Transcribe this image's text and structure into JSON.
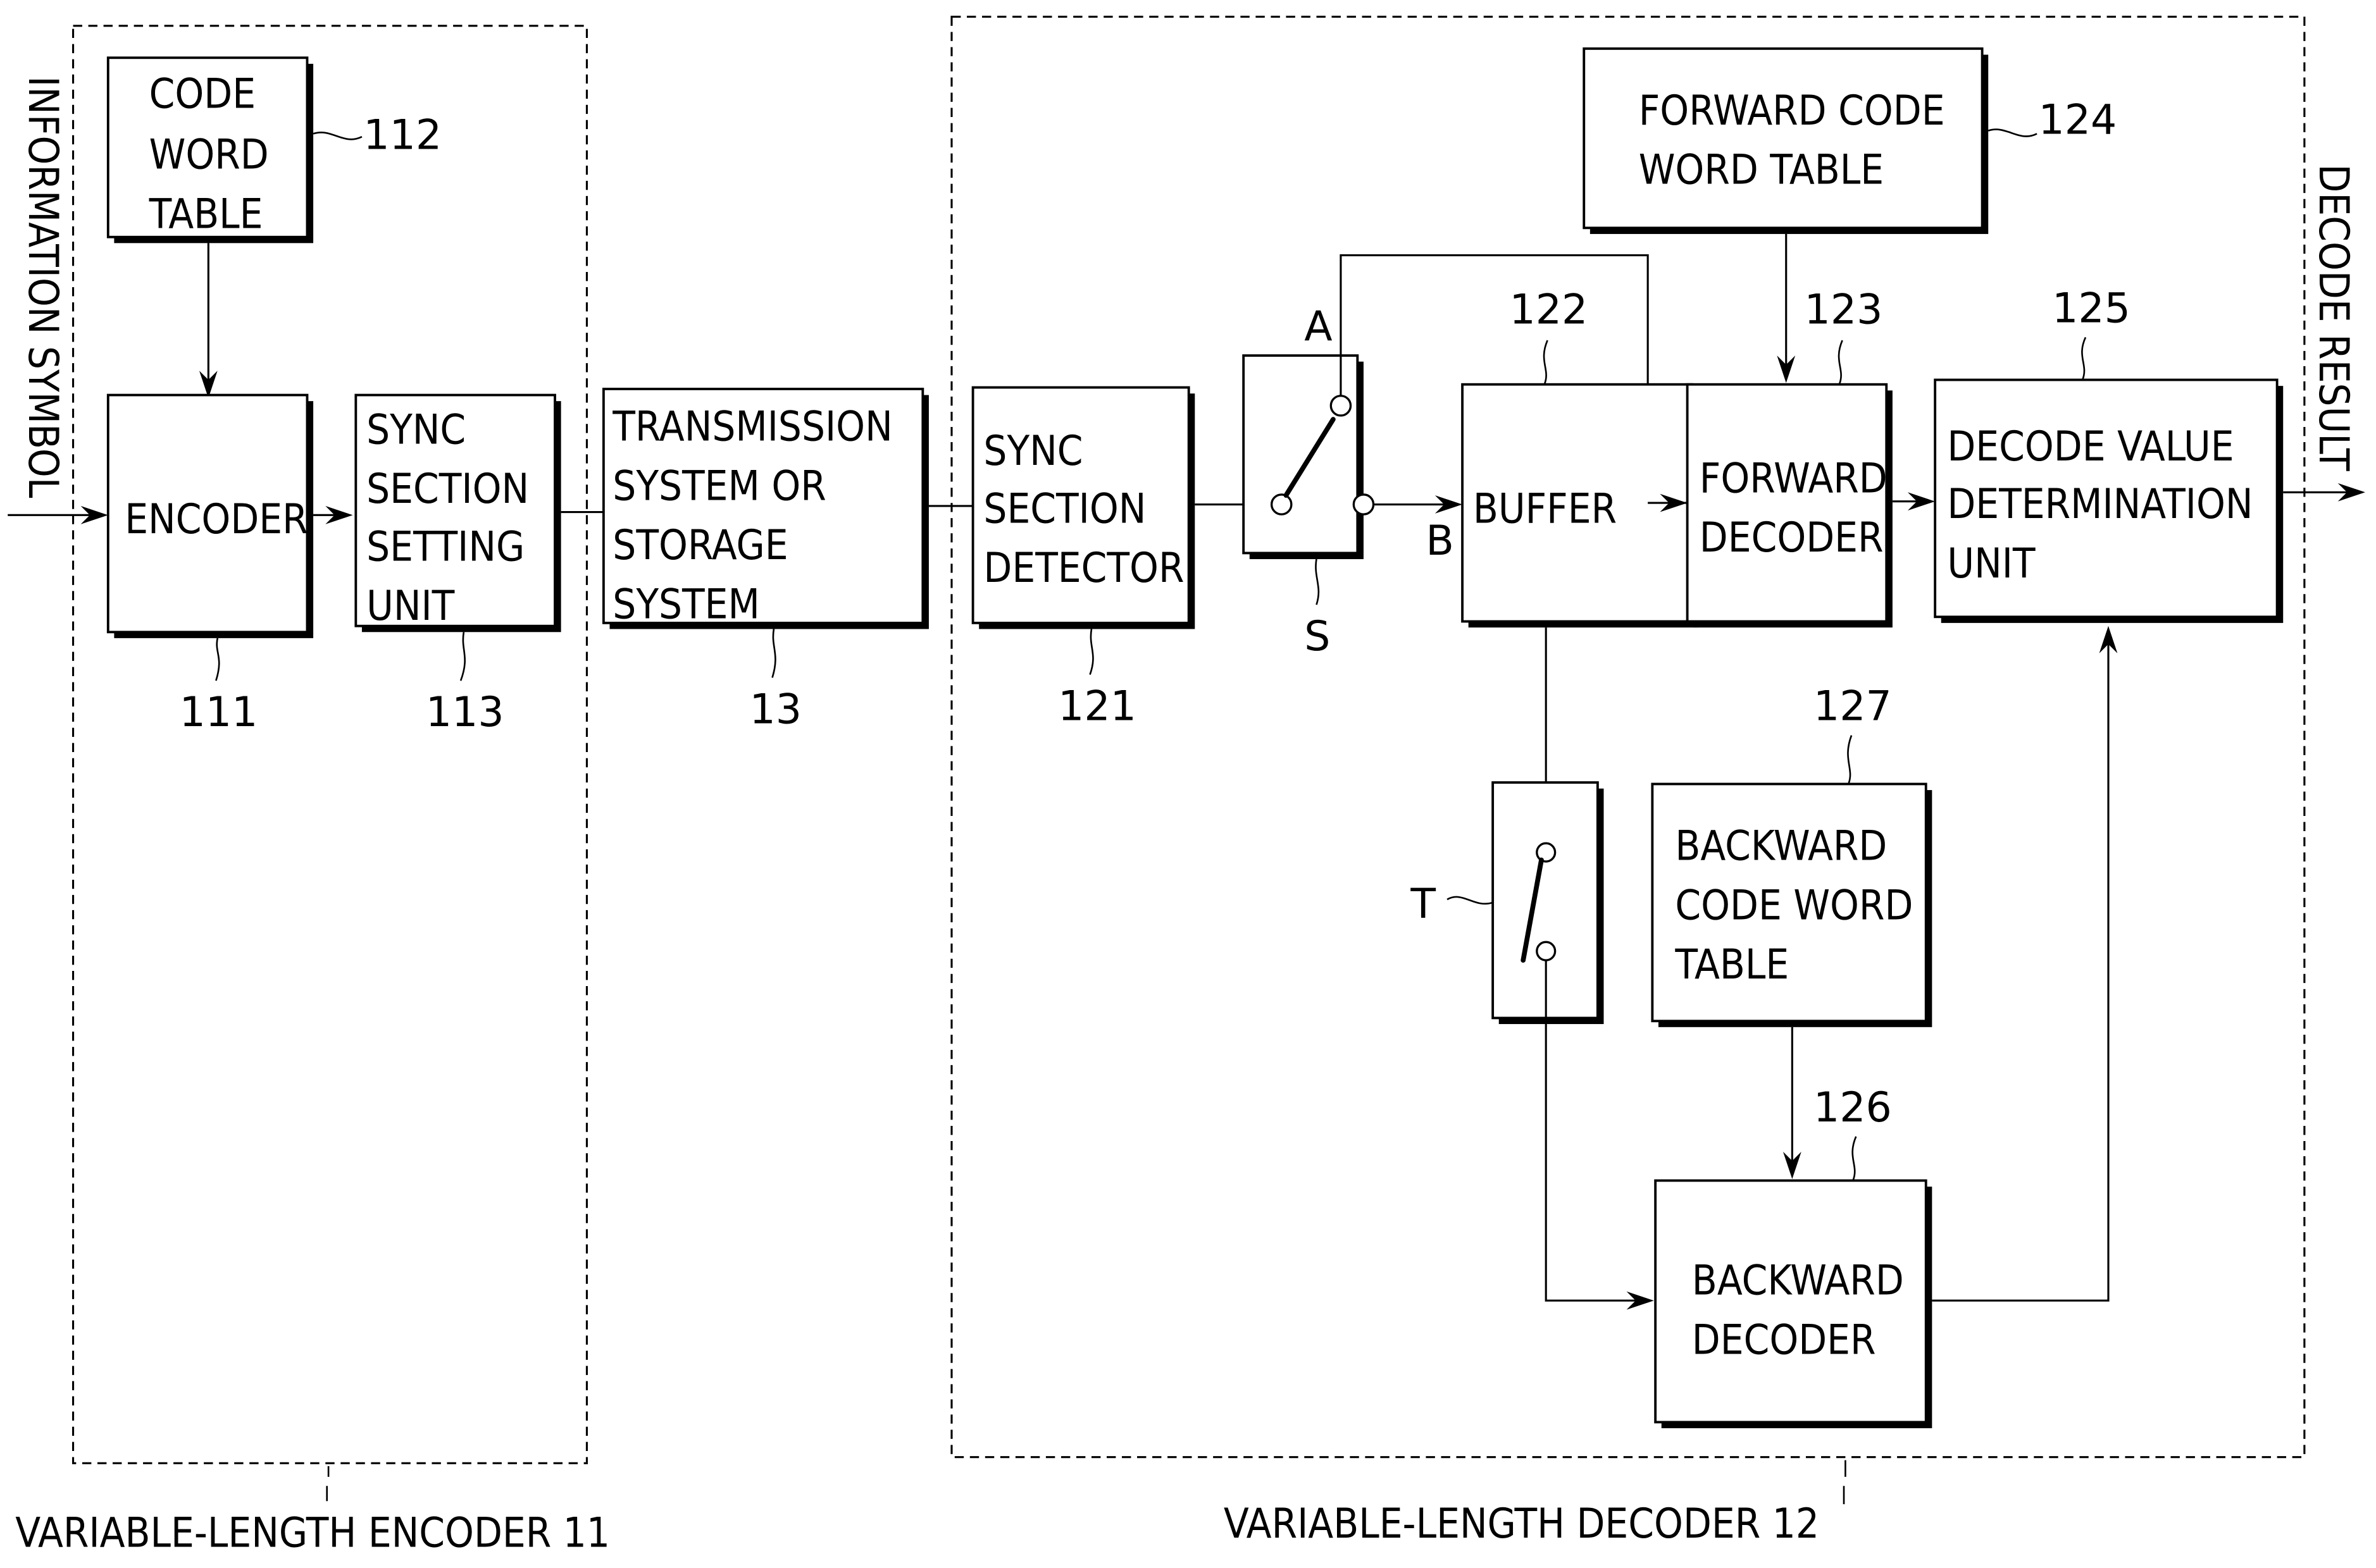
{
  "diagram": {
    "inputs": {
      "information_symbol": "INFORMATION SYMBOL"
    },
    "outputs": {
      "decode_result": "DECODE RESULT"
    },
    "groups": {
      "encoder": "VARIABLE-LENGTH ENCODER 11",
      "decoder": "VARIABLE-LENGTH DECODER 12"
    },
    "blocks": {
      "code_word_table": {
        "lines": [
          "CODE",
          "WORD",
          "TABLE"
        ],
        "ref": "112"
      },
      "encoder": {
        "lines": [
          "ENCODER"
        ],
        "ref": "111"
      },
      "sync_setting": {
        "lines": [
          "SYNC",
          "SECTION",
          "SETTING",
          "UNIT"
        ],
        "ref": "113"
      },
      "transmission": {
        "lines": [
          "TRANSMISSION",
          "SYSTEM OR",
          "STORAGE",
          "SYSTEM"
        ],
        "ref": "13"
      },
      "sync_detector": {
        "lines": [
          "SYNC",
          "SECTION",
          "DETECTOR"
        ],
        "ref": "121"
      },
      "switch_s": {
        "ref": "S",
        "terminal_a": "A",
        "terminal_b": "B"
      },
      "buffer": {
        "lines": [
          "BUFFER"
        ],
        "ref": "122"
      },
      "forward_table": {
        "lines": [
          "FORWARD CODE",
          "WORD TABLE"
        ],
        "ref": "124"
      },
      "forward_decoder": {
        "lines": [
          "FORWARD",
          "DECODER"
        ],
        "ref": "123"
      },
      "determination": {
        "lines": [
          "DECODE VALUE",
          "DETERMINATION",
          "UNIT"
        ],
        "ref": "125"
      },
      "switch_t": {
        "ref": "T"
      },
      "backward_table": {
        "lines": [
          "BACKWARD",
          "CODE WORD",
          "TABLE"
        ],
        "ref": "127"
      },
      "backward_decoder": {
        "lines": [
          "BACKWARD",
          "DECODER"
        ],
        "ref": "126"
      }
    }
  }
}
